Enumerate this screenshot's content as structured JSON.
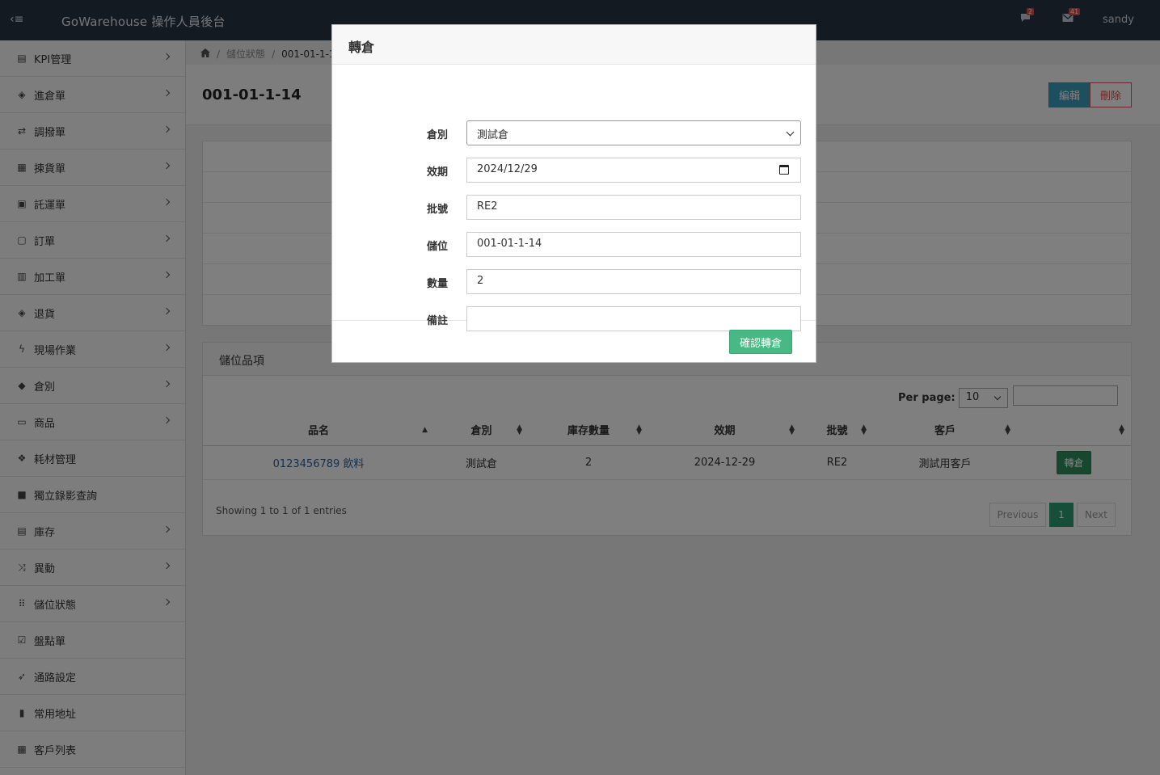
{
  "app": {
    "brand": "GoWarehouse 操作人員後台",
    "user": "sandy",
    "chat_badge": "2",
    "mail_badge": "41"
  },
  "sidebar": {
    "items": [
      {
        "label": "KPI管理",
        "icon": "chart-icon"
      },
      {
        "label": "進倉單",
        "icon": "box-icon"
      },
      {
        "label": "調撥單",
        "icon": "transfer-icon"
      },
      {
        "label": "揀貨單",
        "icon": "list-icon"
      },
      {
        "label": "託運單",
        "icon": "inbox-icon"
      },
      {
        "label": "訂單",
        "icon": "gift-icon"
      },
      {
        "label": "加工單",
        "icon": "document-icon"
      },
      {
        "label": "退貨",
        "icon": "box-icon"
      },
      {
        "label": "現場作業",
        "icon": "bolt-icon"
      },
      {
        "label": "倉別",
        "icon": "tag-icon"
      },
      {
        "label": "商品",
        "icon": "folder-icon"
      },
      {
        "label": "耗材管理",
        "icon": "dropbox-icon"
      },
      {
        "label": "獨立錄影查詢",
        "icon": "video-icon"
      },
      {
        "label": "庫存",
        "icon": "archive-icon"
      },
      {
        "label": "異動",
        "icon": "shuffle-icon"
      },
      {
        "label": "儲位狀態",
        "icon": "grid-icon"
      },
      {
        "label": "盤點單",
        "icon": "checkbox-icon"
      },
      {
        "label": "通路設定",
        "icon": "rocket-icon"
      },
      {
        "label": "常用地址",
        "icon": "book-icon"
      },
      {
        "label": "客戶列表",
        "icon": "calculator-icon"
      }
    ]
  },
  "breadcrumb": {
    "parent": "儲位狀態",
    "current": "001-01-1-1"
  },
  "page": {
    "title": "001-01-1-14",
    "edit_label": "編輯",
    "delete_label": "刪除"
  },
  "items_panel": {
    "title": "儲位品項",
    "per_page_label": "Per page:",
    "per_page_value": "10",
    "columns": [
      "品名",
      "倉別",
      "庫存數量",
      "效期",
      "批號",
      "客戶",
      ""
    ],
    "rows": [
      {
        "name": "0123456789 飲料",
        "warehouse": "測試倉",
        "qty": "2",
        "expiry": "2024-12-29",
        "batch": "RE2",
        "customer": "測試用客戶",
        "action": "轉倉"
      }
    ],
    "showing": "Showing 1 to 1 of 1 entries",
    "prev": "Previous",
    "page": "1",
    "next": "Next"
  },
  "modal": {
    "title": "轉倉",
    "fields": {
      "warehouse": {
        "label": "倉別",
        "value": "測試倉"
      },
      "expiry": {
        "label": "效期",
        "value": "2024/12/29"
      },
      "batch": {
        "label": "批號",
        "value": "RE2"
      },
      "location": {
        "label": "儲位",
        "value": "001-01-1-14"
      },
      "quantity": {
        "label": "數量",
        "value": "2"
      },
      "note": {
        "label": "備註",
        "value": ""
      }
    },
    "confirm_label": "確認轉倉"
  }
}
